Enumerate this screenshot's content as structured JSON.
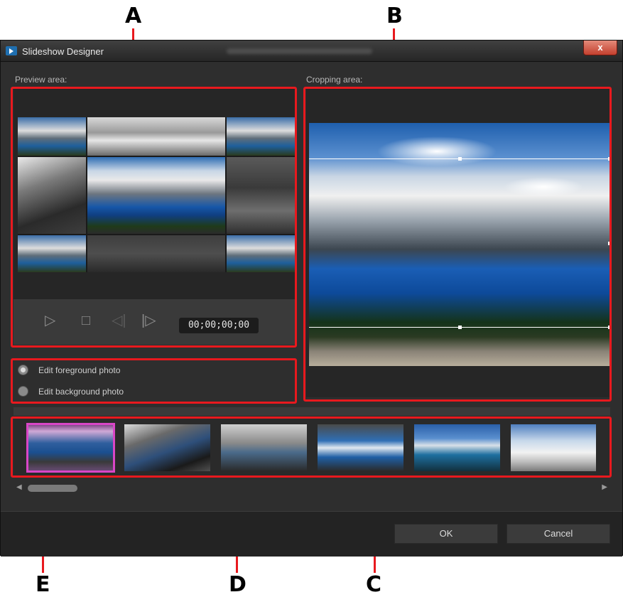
{
  "callouts": {
    "a": "A",
    "b": "B",
    "c": "C",
    "d": "D",
    "e": "E"
  },
  "window": {
    "title": "Slideshow Designer",
    "close_label": "x"
  },
  "preview": {
    "label": "Preview area:",
    "play_icon": "play-icon",
    "stop_icon": "stop-icon",
    "prev_icon": "previous-frame-icon",
    "next_icon": "next-frame-icon",
    "timecode": "00;00;00;00"
  },
  "cropping": {
    "label": "Cropping area:"
  },
  "photo_options": {
    "foreground": "Edit foreground photo",
    "background": "Edit background photo",
    "selected": "foreground"
  },
  "buttons": {
    "ok": "OK",
    "cancel": "Cancel"
  },
  "colors": {
    "highlight_red": "#e8191e",
    "selected_thumb": "#d946c7"
  }
}
